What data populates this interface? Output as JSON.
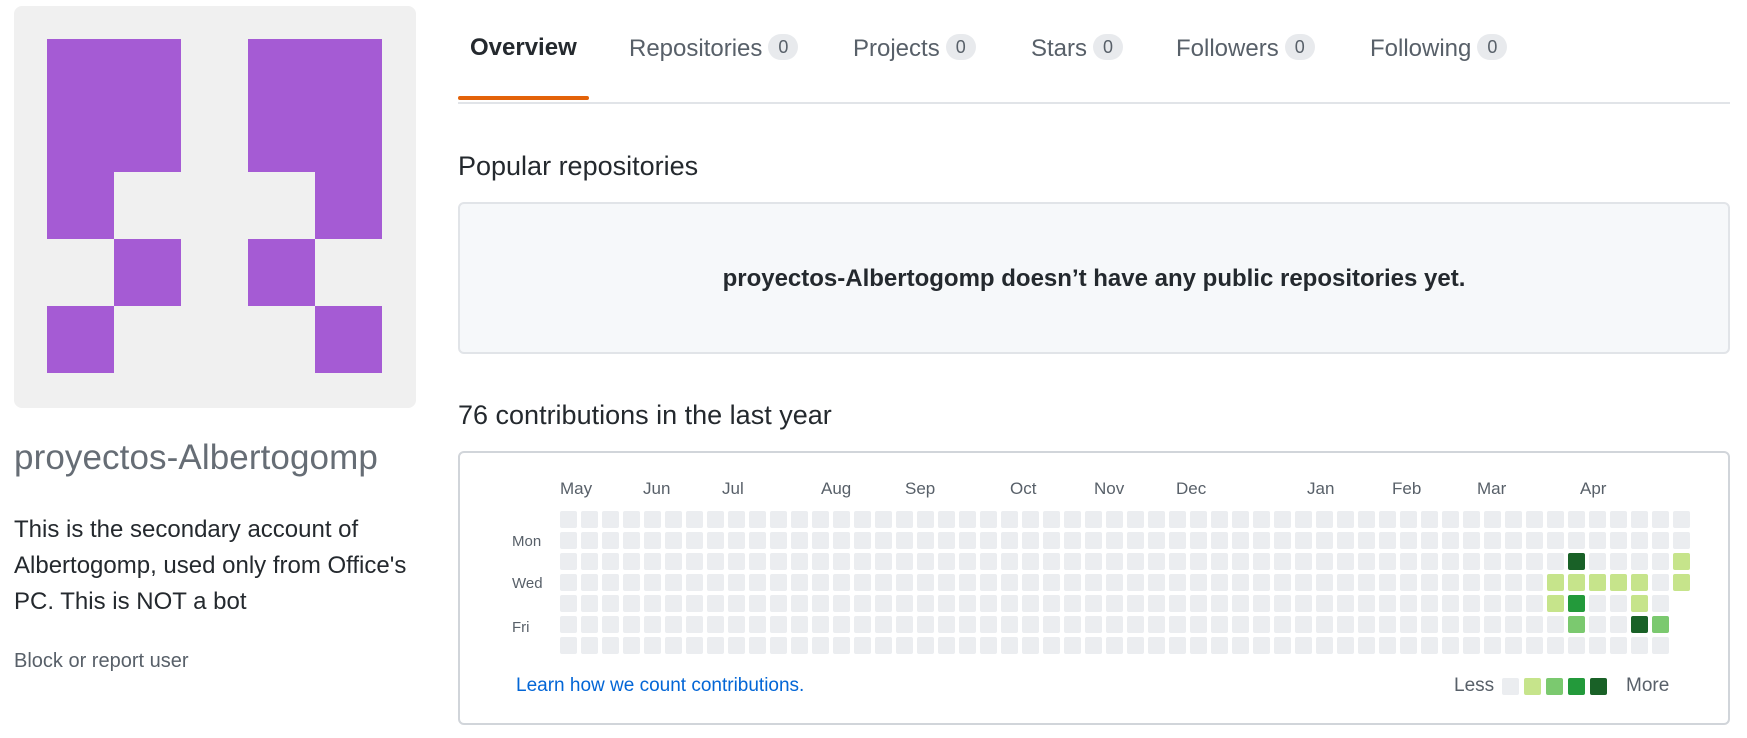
{
  "profile": {
    "username": "proyectos-Albertogomp",
    "bio": "This is the secondary account of Albertogomp, used only from Office's PC. This is NOT a bot",
    "block_label": "Block or report user",
    "avatar_color": "#a55bd4"
  },
  "tabs": [
    {
      "label": "Overview",
      "count": null,
      "active": true
    },
    {
      "label": "Repositories",
      "count": "0"
    },
    {
      "label": "Projects",
      "count": "0"
    },
    {
      "label": "Stars",
      "count": "0"
    },
    {
      "label": "Followers",
      "count": "0"
    },
    {
      "label": "Following",
      "count": "0"
    }
  ],
  "popular": {
    "heading": "Popular repositories",
    "empty_message": "proyectos-Albertogomp doesn’t have any public repositories yet."
  },
  "contributions": {
    "heading": "76 contributions in the last year",
    "months": [
      "May",
      "Jun",
      "Jul",
      "Aug",
      "Sep",
      "Oct",
      "Nov",
      "Dec",
      "Jan",
      "Feb",
      "Mar",
      "Apr"
    ],
    "days": [
      "Mon",
      "Wed",
      "Fri"
    ],
    "learn_link": "Learn how we count contributions.",
    "legend_less": "Less",
    "legend_more": "More",
    "colors": [
      "#ebedf0",
      "#c6e48b",
      "#7bc96f",
      "#239a3b",
      "#196127"
    ],
    "active_cells": [
      {
        "week": 47,
        "day": 3,
        "level": 1
      },
      {
        "week": 47,
        "day": 4,
        "level": 1
      },
      {
        "week": 48,
        "day": 2,
        "level": 4
      },
      {
        "week": 48,
        "day": 3,
        "level": 1
      },
      {
        "week": 48,
        "day": 4,
        "level": 3
      },
      {
        "week": 48,
        "day": 5,
        "level": 2
      },
      {
        "week": 49,
        "day": 3,
        "level": 1
      },
      {
        "week": 50,
        "day": 3,
        "level": 1
      },
      {
        "week": 51,
        "day": 3,
        "level": 1
      },
      {
        "week": 51,
        "day": 4,
        "level": 1
      },
      {
        "week": 51,
        "day": 5,
        "level": 4
      },
      {
        "week": 52,
        "day": 5,
        "level": 2
      },
      {
        "week": 53,
        "day": 2,
        "level": 1
      },
      {
        "week": 53,
        "day": 3,
        "level": 1
      }
    ]
  }
}
